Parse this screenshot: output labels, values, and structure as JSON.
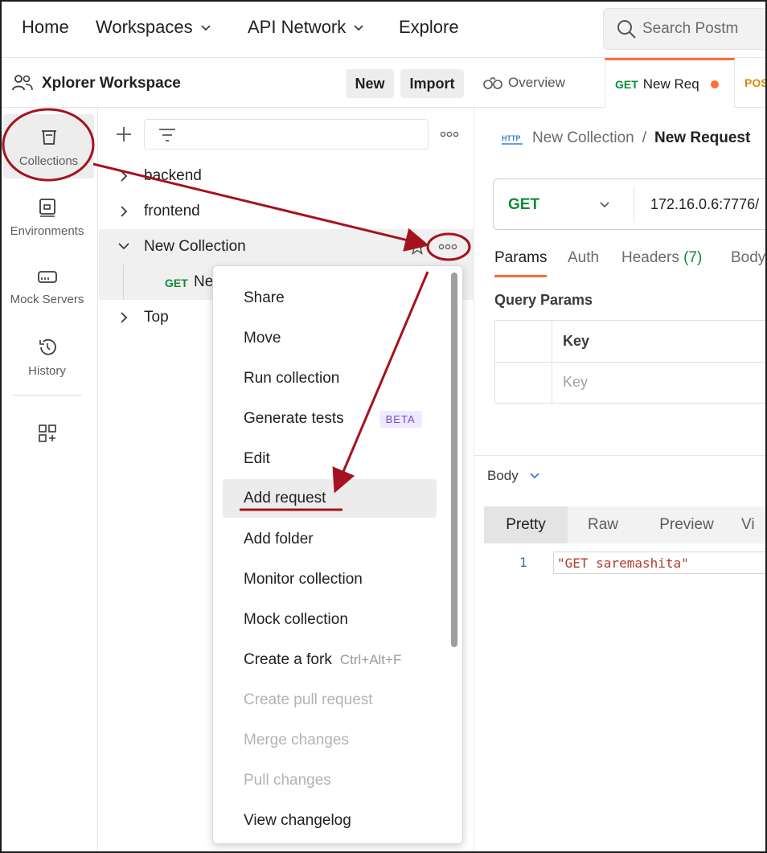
{
  "topnav": {
    "home": "Home",
    "workspaces": "Workspaces",
    "api_network": "API Network",
    "explore": "Explore",
    "search_placeholder": "Search Postm"
  },
  "workspace": {
    "title": "Xplorer Workspace",
    "new_label": "New",
    "import_label": "Import"
  },
  "rail": {
    "collections": "Collections",
    "environments": "Environments",
    "mock_servers": "Mock Servers",
    "history": "History"
  },
  "tree": {
    "items": [
      {
        "label": "backend"
      },
      {
        "label": "frontend"
      },
      {
        "label": "New Collection"
      },
      {
        "method": "GET",
        "label": "Ne"
      },
      {
        "label": "Top"
      }
    ]
  },
  "tabs": {
    "overview": "Overview",
    "active_method": "GET",
    "active_label": "New Req",
    "next_method": "POS"
  },
  "request": {
    "breadcrumb_collection": "New Collection",
    "breadcrumb_sep": "/",
    "breadcrumb_request": "New Request",
    "http_badge": "HTTP",
    "method": "GET",
    "url": "172.16.0.6:7776/",
    "tabs": {
      "params": "Params",
      "auth": "Auth",
      "headers": "Headers",
      "headers_count": "(7)",
      "body": "Body"
    },
    "query_params_title": "Query Params",
    "col_key": "Key",
    "key_placeholder": "Key"
  },
  "response": {
    "body_label": "Body",
    "formats": [
      "Pretty",
      "Raw",
      "Preview",
      "Vi"
    ],
    "line_no": "1",
    "line_text": "\"GET saremashita\""
  },
  "menu": {
    "items": [
      {
        "label": "Share",
        "disabled": false
      },
      {
        "label": "Move",
        "disabled": false
      },
      {
        "label": "Run collection",
        "disabled": false
      },
      {
        "label": "Generate tests",
        "disabled": false,
        "badge": "BETA"
      },
      {
        "label": "Edit",
        "disabled": false
      },
      {
        "label": "Add request",
        "disabled": false,
        "highlighted": true
      },
      {
        "label": "Add folder",
        "disabled": false
      },
      {
        "label": "Monitor collection",
        "disabled": false
      },
      {
        "label": "Mock collection",
        "disabled": false
      },
      {
        "label": "Create a fork",
        "disabled": false,
        "shortcut": "Ctrl+Alt+F"
      },
      {
        "label": "Create pull request",
        "disabled": true
      },
      {
        "label": "Merge changes",
        "disabled": true
      },
      {
        "label": "Pull changes",
        "disabled": true
      },
      {
        "label": "View changelog",
        "disabled": false
      }
    ]
  },
  "colors": {
    "accent": "#ff6c37",
    "get": "#0f8a3a",
    "annotation": "#a5121f"
  }
}
